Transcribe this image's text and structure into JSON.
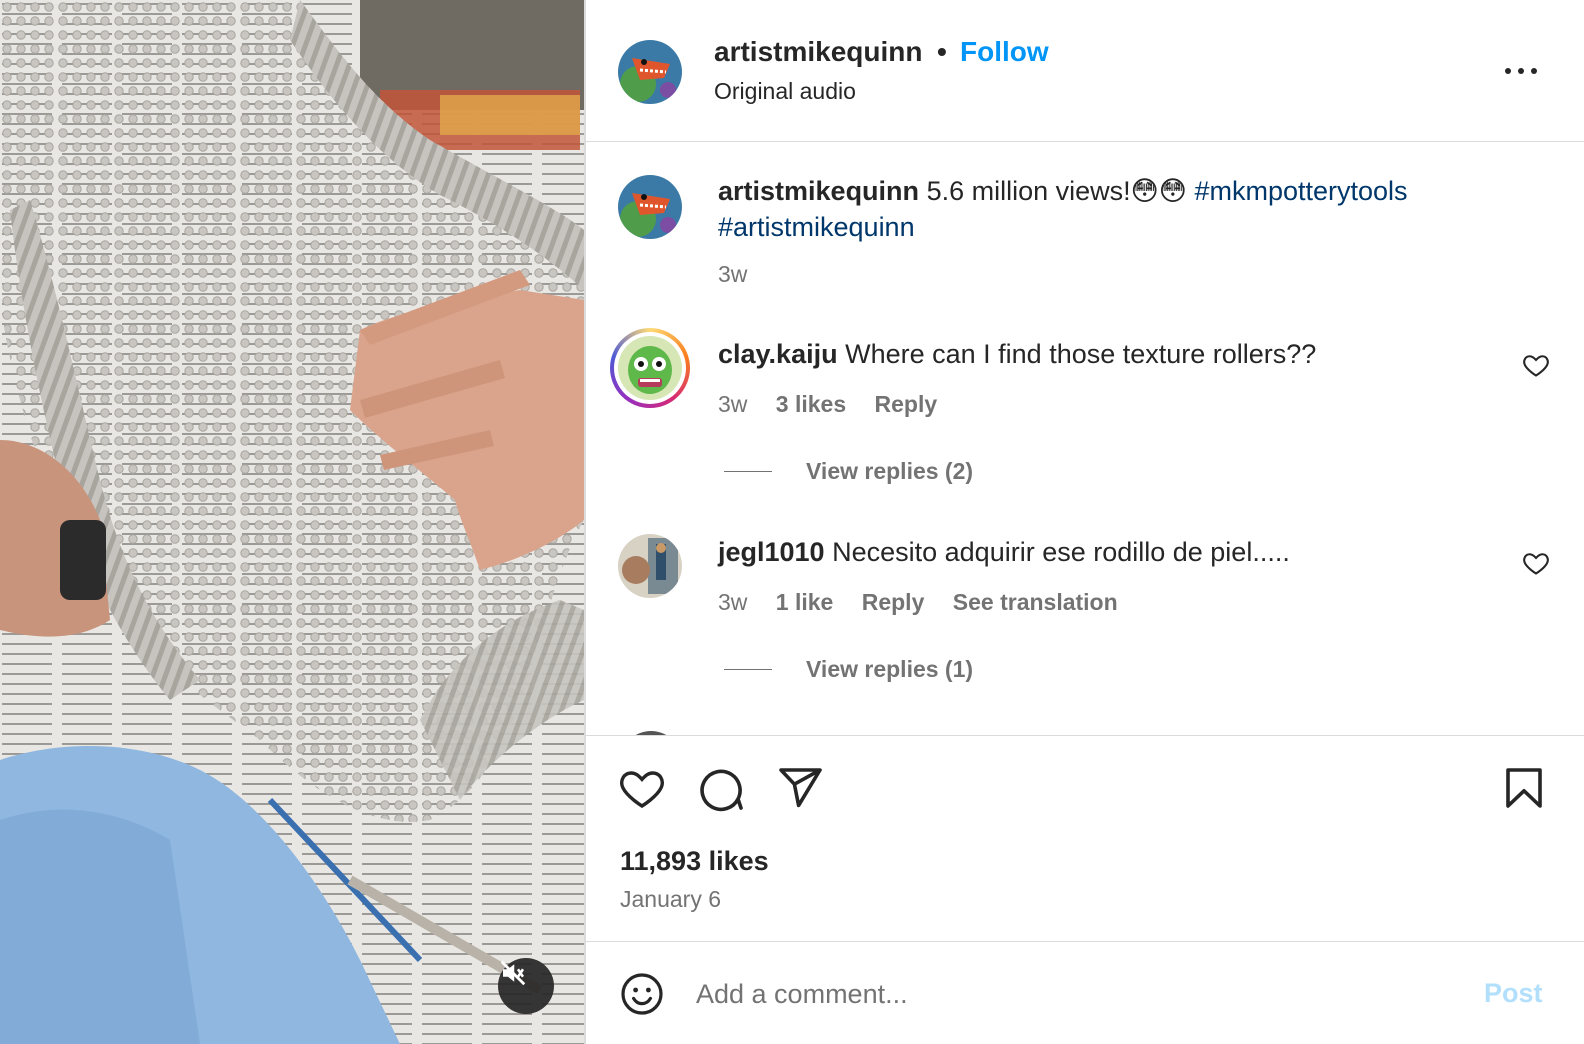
{
  "post": {
    "username": "artistmikequinn",
    "separator": "•",
    "follow_label": "Follow",
    "audio": "Original audio"
  },
  "caption": {
    "username": "artistmikequinn",
    "text": "5.6 million views!😳😳",
    "hashtags": [
      "#mkmpotterytools",
      "#artistmikequinn"
    ],
    "time": "3w"
  },
  "comments": [
    {
      "username": "clay.kaiju",
      "text": "Where can I find those texture rollers??",
      "time": "3w",
      "likes": "3 likes",
      "reply_label": "Reply",
      "view_replies": "View replies (2)"
    },
    {
      "username": "jegl1010",
      "text": "Necesito adquirir ese rodillo de piel.....",
      "time": "3w",
      "likes": "1 like",
      "reply_label": "Reply",
      "translation_label": "See translation",
      "view_replies": "View replies (1)"
    }
  ],
  "actions": {
    "icons": [
      "heart-icon",
      "comment-icon",
      "share-icon",
      "bookmark-icon"
    ],
    "likes": "11,893 likes",
    "date": "January 6"
  },
  "add_comment": {
    "placeholder": "Add a comment...",
    "post_label": "Post"
  },
  "colors": {
    "link_blue": "#0095f6",
    "hashtag_blue": "#00376b",
    "secondary_text": "#737373",
    "post_disabled": "#b2dffc"
  }
}
